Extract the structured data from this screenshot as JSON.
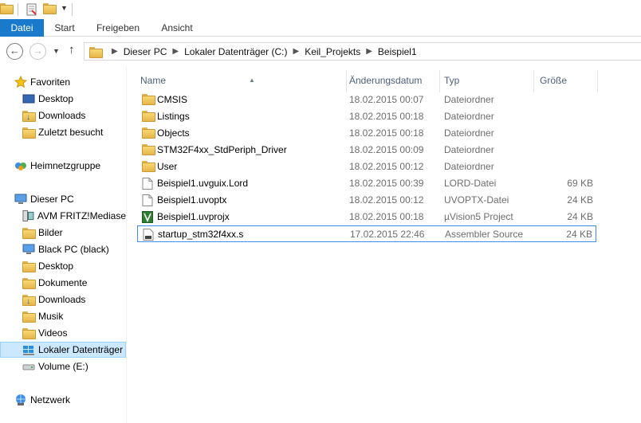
{
  "ribbon": {
    "tabs": [
      "Datei",
      "Start",
      "Freigeben",
      "Ansicht"
    ]
  },
  "address": {
    "crumbs": [
      "Dieser PC",
      "Lokaler Datenträger (C:)",
      "Keil_Projekts",
      "Beispiel1"
    ]
  },
  "sidebar": {
    "items": [
      {
        "label": "Favoriten",
        "icon": "star-icon"
      },
      {
        "label": "Desktop",
        "icon": "desktop-icon"
      },
      {
        "label": "Downloads",
        "icon": "downloads-folder-icon"
      },
      {
        "label": "Zuletzt besucht",
        "icon": "recent-places-icon"
      },
      {
        "label": "Heimnetzgruppe",
        "icon": "homegroup-icon"
      },
      {
        "label": "Dieser PC",
        "icon": "computer-icon"
      },
      {
        "label": "AVM FRITZ!Mediase",
        "icon": "media-server-icon"
      },
      {
        "label": "Bilder",
        "icon": "pictures-folder-icon"
      },
      {
        "label": "Black PC (black)",
        "icon": "network-computer-icon"
      },
      {
        "label": "Desktop",
        "icon": "desktop-folder-icon"
      },
      {
        "label": "Dokumente",
        "icon": "documents-folder-icon"
      },
      {
        "label": "Downloads",
        "icon": "downloads-folder-icon"
      },
      {
        "label": "Musik",
        "icon": "music-folder-icon"
      },
      {
        "label": "Videos",
        "icon": "videos-folder-icon"
      },
      {
        "label": "Lokaler Datenträger",
        "icon": "local-disk-icon"
      },
      {
        "label": "Volume (E:)",
        "icon": "drive-icon"
      },
      {
        "label": "Netzwerk",
        "icon": "network-icon"
      }
    ]
  },
  "columns": {
    "name": "Name",
    "date": "Änderungsdatum",
    "type": "Typ",
    "size": "Größe"
  },
  "files": [
    {
      "name": "CMSIS",
      "date": "18.02.2015 00:07",
      "type": "Dateiordner",
      "size": "",
      "icon": "folder-icon"
    },
    {
      "name": "Listings",
      "date": "18.02.2015 00:18",
      "type": "Dateiordner",
      "size": "",
      "icon": "folder-icon"
    },
    {
      "name": "Objects",
      "date": "18.02.2015 00:18",
      "type": "Dateiordner",
      "size": "",
      "icon": "folder-icon"
    },
    {
      "name": "STM32F4xx_StdPeriph_Driver",
      "date": "18.02.2015 00:09",
      "type": "Dateiordner",
      "size": "",
      "icon": "folder-icon"
    },
    {
      "name": "User",
      "date": "18.02.2015 00:12",
      "type": "Dateiordner",
      "size": "",
      "icon": "folder-icon"
    },
    {
      "name": "Beispiel1.uvguix.Lord",
      "date": "18.02.2015 00:39",
      "type": "LORD-Datei",
      "size": "69 KB",
      "icon": "file-icon"
    },
    {
      "name": "Beispiel1.uvoptx",
      "date": "18.02.2015 00:12",
      "type": "UVOPTX-Datei",
      "size": "24 KB",
      "icon": "file-icon"
    },
    {
      "name": "Beispiel1.uvprojx",
      "date": "18.02.2015 00:18",
      "type": "µVision5 Project",
      "size": "24 KB",
      "icon": "uvision-project-icon"
    },
    {
      "name": "startup_stm32f4xx.s",
      "date": "17.02.2015 22:46",
      "type": "Assembler Source",
      "size": "24 KB",
      "icon": "assembler-file-icon"
    }
  ]
}
